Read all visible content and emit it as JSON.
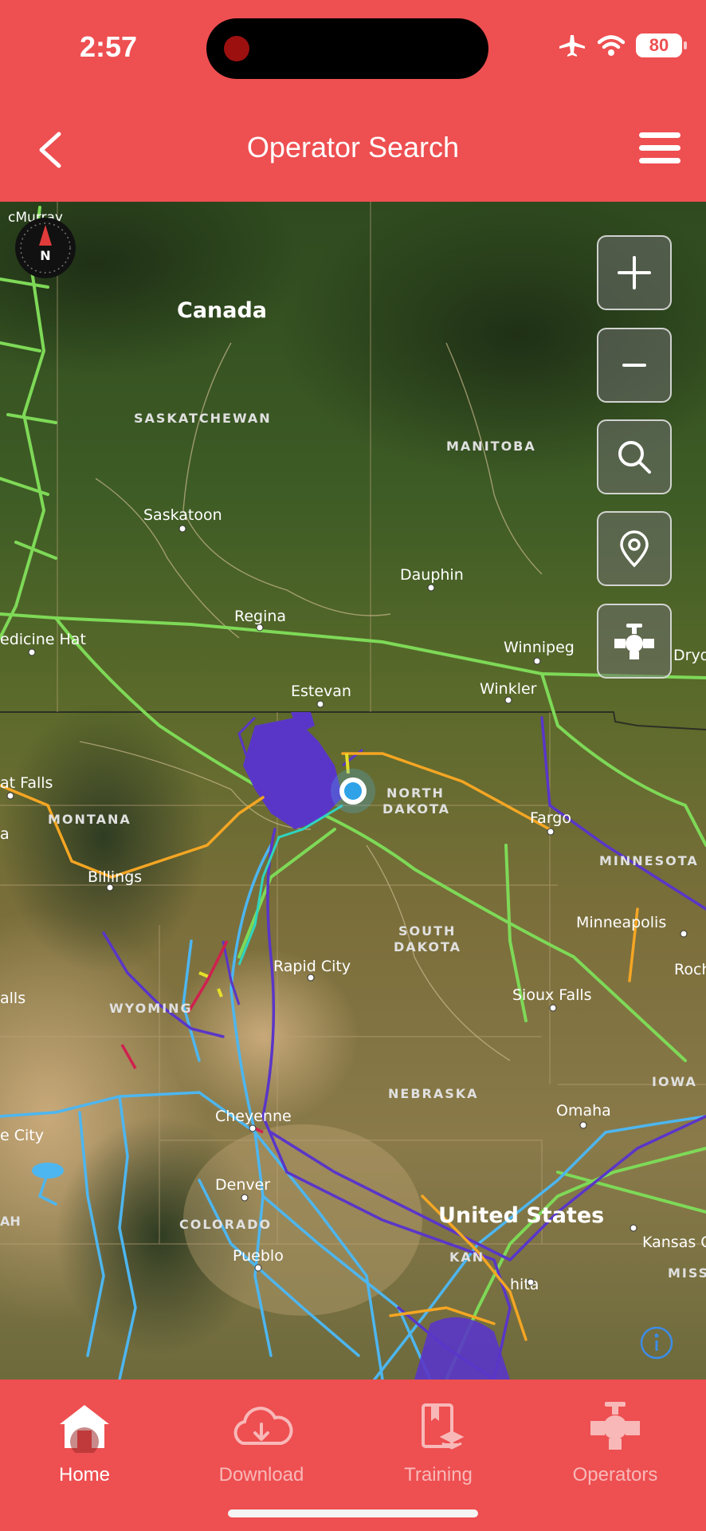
{
  "status_bar": {
    "time": "2:57",
    "battery": "80"
  },
  "header": {
    "title": "Operator Search"
  },
  "map": {
    "labels": {
      "country_canada": "Canada",
      "country_us": "United States",
      "saskatchewan": "SASKATCHEWAN",
      "manitoba": "MANITOBA",
      "montana": "MONTANA",
      "north_dakota_1": "NORTH",
      "north_dakota_2": "DAKOTA",
      "south_dakota_1": "SOUTH",
      "south_dakota_2": "DAKOTA",
      "minnesota": "MINNESOTA",
      "wyoming": "WYOMING",
      "nebraska": "NEBRASKA",
      "iowa": "IOWA",
      "colorado": "COLORADO",
      "kansas": "KAN",
      "missouri": "MISS",
      "utah": "AH",
      "saskatoon": "Saskatoon",
      "regina": "Regina",
      "dauphin": "Dauphin",
      "winnipeg": "Winnipeg",
      "winkler": "Winkler",
      "estevan": "Estevan",
      "medicine_hat": "edicine Hat",
      "fort_mcmurray": "cMurray",
      "great_falls": "at Falls",
      "billings": "Billings",
      "fargo": "Fargo",
      "minneapolis": "Minneapolis",
      "rochester": "Roch",
      "rapid_city": "Rapid City",
      "sioux_falls": "Sioux Falls",
      "cheyenne": "Cheyenne",
      "denver": "Denver",
      "pueblo": "Pueblo",
      "omaha": "Omaha",
      "kansas_city": "Kansas C",
      "wichita": "hita",
      "salt_lake": "e City",
      "helena": "a",
      "idaho_falls": "alls",
      "dryden": "Dryd"
    },
    "compass_letter": "N"
  },
  "map_controls": {
    "zoom_in": "plus-icon",
    "zoom_out": "minus-icon",
    "search": "search-icon",
    "locate": "location-pin-icon",
    "pipelines": "valve-icon"
  },
  "tabs": [
    {
      "label": "Home",
      "icon": "home-icon",
      "active": true
    },
    {
      "label": "Download",
      "icon": "cloud-download-icon",
      "active": false
    },
    {
      "label": "Training",
      "icon": "training-book-icon",
      "active": false
    },
    {
      "label": "Operators",
      "icon": "valve-icon",
      "active": false
    }
  ],
  "colors": {
    "brand": "#EE4F51",
    "pipeline_green": "#7ED957",
    "pipeline_blue": "#4DB6F0",
    "pipeline_purple": "#5A36C8",
    "pipeline_orange": "#F5A623"
  }
}
